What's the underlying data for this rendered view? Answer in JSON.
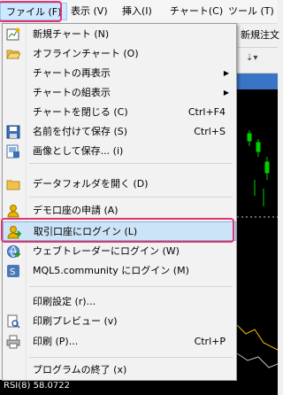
{
  "menubar": {
    "items": [
      {
        "label": "ファイル (F)"
      },
      {
        "label": "表示 (V)"
      },
      {
        "label": "挿入(I)"
      },
      {
        "label": "チャート(C)"
      },
      {
        "label": "ツール (T)"
      }
    ]
  },
  "background": {
    "order_text": "新規注文",
    "rsi_label": "RSI(8) 58.0722"
  },
  "menu": {
    "items": [
      {
        "label": "新規チャート (N)",
        "icon": "new-chart-icon"
      },
      {
        "label": "オフラインチャート (O)",
        "icon": "folder-open-icon"
      },
      {
        "label": "チャートの再表示",
        "submenu": "▶"
      },
      {
        "label": "チャートの組表示",
        "submenu": "▶"
      },
      {
        "label": "チャートを閉じる (C)",
        "shortcut": "Ctrl+F4"
      },
      {
        "label": "名前を付けて保存 (S)",
        "shortcut": "Ctrl+S",
        "icon": "save-icon"
      },
      {
        "label": "画像として保存... (i)",
        "icon": "image-save-icon"
      },
      {
        "label": "データフォルダを開く (D)",
        "icon": "folder-icon"
      },
      {
        "label": "デモ口座の申請 (A)",
        "icon": "demo-account-icon"
      },
      {
        "label": "取引口座にログイン (L)",
        "icon": "login-icon"
      },
      {
        "label": "ウェブトレーダーにログイン (W)",
        "icon": "webtrader-icon"
      },
      {
        "label": "MQL5.community にログイン (M)",
        "icon": "mql5-icon"
      },
      {
        "label": "印刷設定 (r)..."
      },
      {
        "label": "印刷プレビュー (v)",
        "icon": "print-preview-icon"
      },
      {
        "label": "印刷 (P)...",
        "shortcut": "Ctrl+P",
        "icon": "print-icon"
      },
      {
        "label": "プログラムの終了 (x)"
      }
    ]
  }
}
